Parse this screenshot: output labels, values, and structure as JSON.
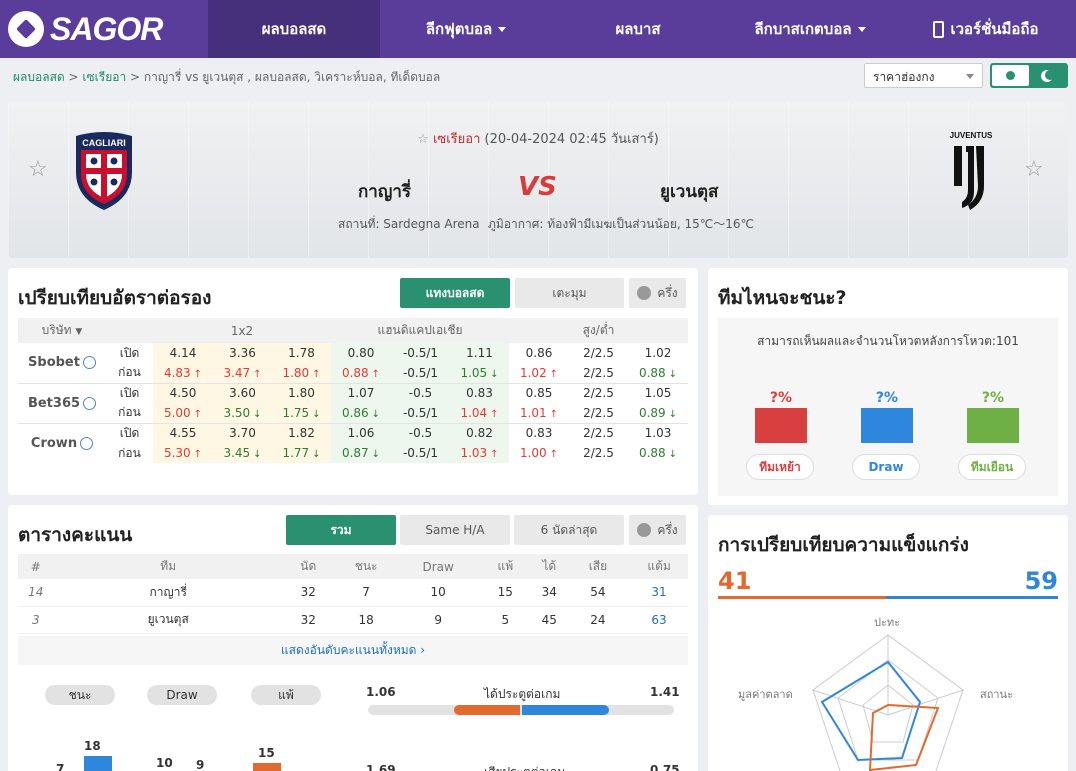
{
  "nav": {
    "logo": "SAGOR",
    "items": [
      "ผลบอลสด",
      "ลีกฟุตบอล",
      "ผลบาส",
      "ลีกบาสเกตบอล",
      "เวอร์ชั่นมือถือ"
    ]
  },
  "breadcrumb": {
    "home": "ผลบอลสด",
    "league": "เซเรียอา",
    "rest": "กาญารี่ vs ยูเวนตุส , ผลบอลสด, วิเคราะห์บอล, ทีเด็ดบอล",
    "sep": ">"
  },
  "odds_select": "ราคาฮ่องกง",
  "match": {
    "league": "เซเรียอา",
    "datetime": "(20-04-2024 02:45 วันเสาร์)",
    "home": "กาญารี่",
    "away": "ยูเวนตุส",
    "vs": "VS",
    "venue": "สถานที่: Sardegna Arena",
    "weather": "ภูมิอากาศ: ท้องฟ้ามีเมฆเป็นส่วนน้อย, 15℃～16℃",
    "home_crest_text": "CAGLIARI",
    "away_crest_text": "JUVENTUS"
  },
  "odds": {
    "title": "เปรียบเทียบอัตราต่อรอง",
    "tab_live": "แทงบอลสด",
    "tab_corner": "เตะมุม",
    "tab_half": "ครึ่ง",
    "headers": [
      "บริษัท",
      "1x2",
      "แฮนดิแคปเอเชีย",
      "สูง/ต่ำ"
    ],
    "open": "เปิด",
    "before": "ก่อน",
    "rows": [
      {
        "name": "Sbobet",
        "open": [
          "4.14",
          "3.36",
          "1.78",
          "0.80",
          "-0.5/1",
          "1.11",
          "0.86",
          "2/2.5",
          "1.02"
        ],
        "pre": [
          "4.83",
          "3.47",
          "1.80",
          "0.88",
          "-0.5/1",
          "1.05",
          "1.02",
          "2/2.5",
          "0.88"
        ],
        "dir": [
          "u",
          "u",
          "u",
          "u",
          "",
          "d",
          "u",
          "",
          "d"
        ]
      },
      {
        "name": "Bet365",
        "open": [
          "4.50",
          "3.60",
          "1.80",
          "1.07",
          "-0.5",
          "0.83",
          "0.85",
          "2/2.5",
          "1.05"
        ],
        "pre": [
          "5.00",
          "3.50",
          "1.75",
          "0.86",
          "-0.5/1",
          "1.04",
          "1.01",
          "2/2.5",
          "0.89"
        ],
        "dir": [
          "u",
          "d",
          "d",
          "d",
          "",
          "u",
          "u",
          "",
          "d"
        ]
      },
      {
        "name": "Crown",
        "open": [
          "4.55",
          "3.70",
          "1.82",
          "1.06",
          "-0.5",
          "0.82",
          "0.83",
          "2/2.5",
          "1.03"
        ],
        "pre": [
          "5.30",
          "3.45",
          "1.77",
          "0.87",
          "-0.5/1",
          "1.03",
          "1.00",
          "2/2.5",
          "0.88"
        ],
        "dir": [
          "u",
          "d",
          "d",
          "d",
          "",
          "u",
          "u",
          "",
          "d"
        ]
      }
    ]
  },
  "vote": {
    "title": "ทีมไหนจะชนะ?",
    "sub": "สามารถเห็นผลและจำนวนโหวตหลังการโหวต:101",
    "pct": [
      "?%",
      "?%",
      "?%"
    ],
    "labels": [
      "ทีมเหย้า",
      "Draw",
      "ทีมเยือน"
    ],
    "colors": [
      "#d84040",
      "#2f86dd",
      "#6fb046"
    ]
  },
  "standings": {
    "title": "ตารางคะแนน",
    "tabs": [
      "รวม",
      "Same H/A",
      "6 นัดล่าสุด",
      "ครึ่ง"
    ],
    "headers": [
      "#",
      "ทีม",
      "นัด",
      "ชนะ",
      "Draw",
      "แพ้",
      "ได้",
      "เสีย",
      "แต้ม"
    ],
    "rows": [
      [
        "14",
        "กาญารี่",
        "32",
        "7",
        "10",
        "15",
        "34",
        "54",
        "31"
      ],
      [
        "3",
        "ยูเวนตุส",
        "32",
        "18",
        "9",
        "5",
        "45",
        "24",
        "63"
      ]
    ],
    "show_all": "แสดงอันดับคะแนนทั้งหมด"
  },
  "stats": {
    "pills": [
      "ชนะ",
      "Draw",
      "แพ้"
    ],
    "goal_label": "ได้ประตูต่อเกม",
    "goal_home": "1.06",
    "goal_away": "1.41",
    "next_home": "1.69",
    "next_label": "เสียประตูต่อเกม",
    "next_away": "0.75",
    "bars": [
      "7",
      "18",
      "10",
      "9",
      "15"
    ]
  },
  "strength": {
    "title": "การเปรียบเทียบความแข็งแกร่ง",
    "home": "41",
    "away": "59",
    "axes": [
      "ปะทะ",
      "สถานะ",
      "มูลค่าตลาด"
    ]
  }
}
